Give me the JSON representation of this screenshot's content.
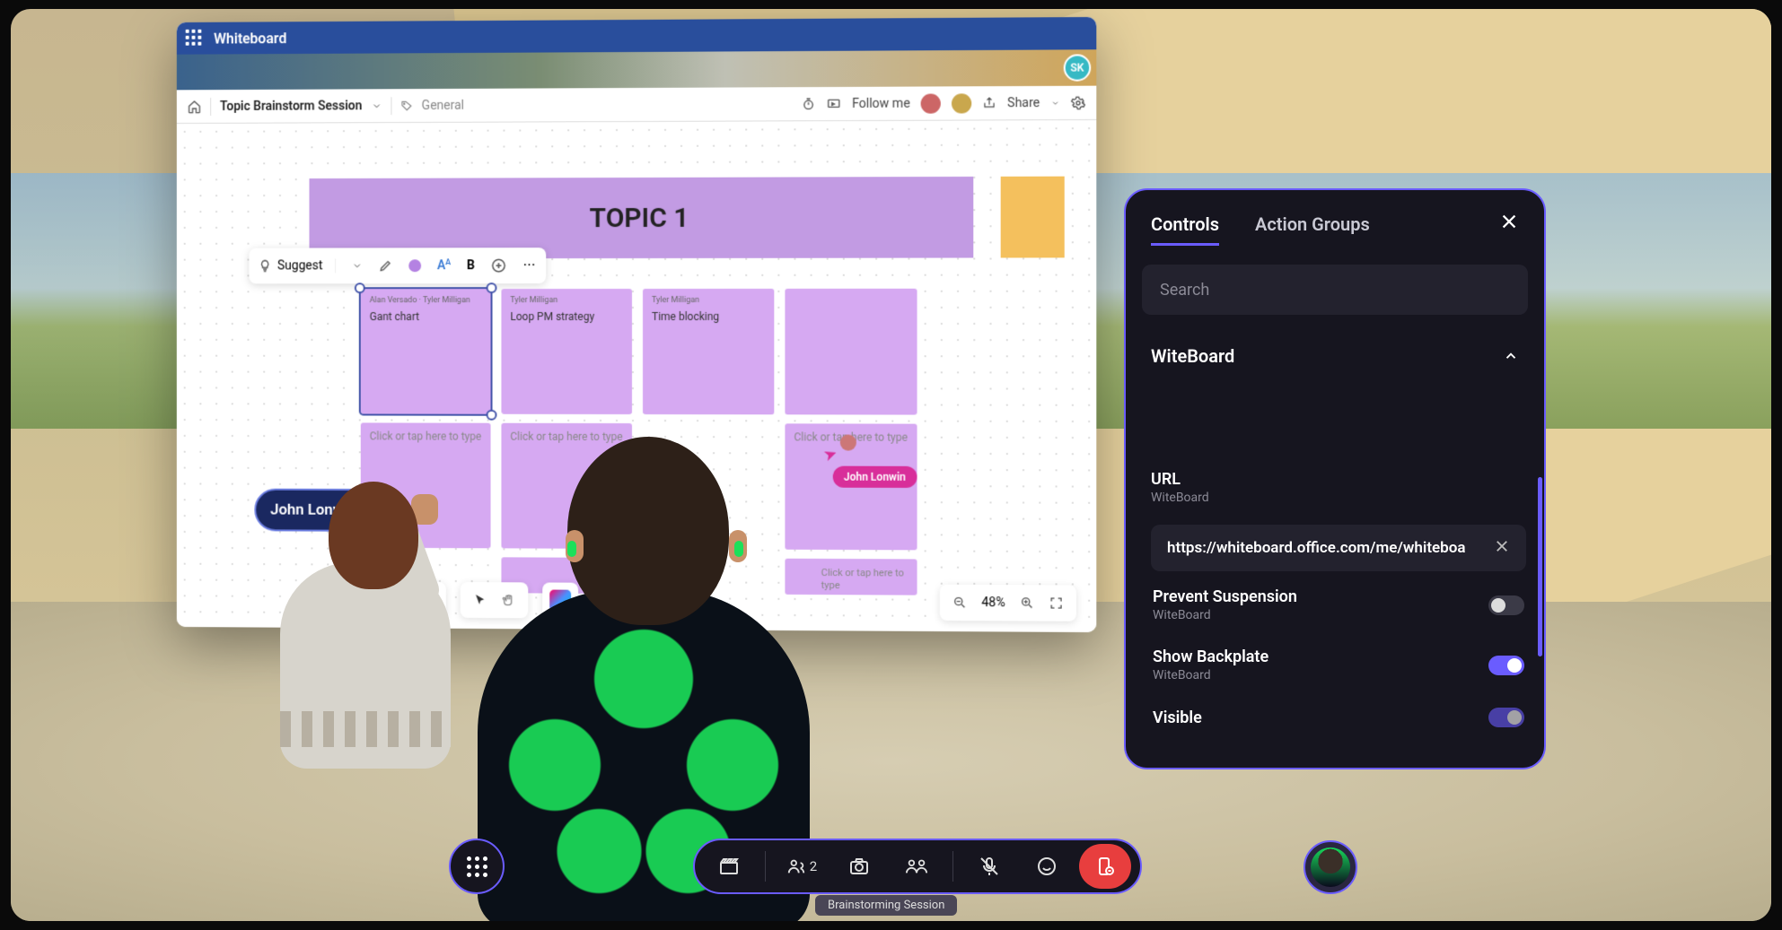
{
  "whiteboard": {
    "app_name": "Whiteboard",
    "board_title": "Topic Brainstorm Session",
    "tag": "General",
    "user_initials": "SK",
    "follow_me": "Follow me",
    "share": "Share",
    "topic_header": "TOPIC 1",
    "suggest": "Suggest",
    "zoom": "48%",
    "placeholder_text": "Click or tap here to type",
    "notes_row1": [
      {
        "author": "Alan Versado · Tyler Milligan",
        "text": "Gant chart"
      },
      {
        "author": "Tyler Milligan",
        "text": "Loop PM strategy"
      },
      {
        "author": "Tyler Milligan",
        "text": "Time blocking"
      },
      {
        "author": "",
        "text": ""
      }
    ],
    "cursor_user": "John Lonwin",
    "name_pill": "John Lonwin"
  },
  "panel": {
    "tab_controls": "Controls",
    "tab_action_groups": "Action Groups",
    "search_placeholder": "Search",
    "section_title": "WiteBoard",
    "url_label": "URL",
    "url_sub": "WiteBoard",
    "url_value": "https://whiteboard.office.com/me/whiteboa",
    "prevent_label": "Prevent Suspension",
    "prevent_sub": "WiteBoard",
    "backplate_label": "Show Backplate",
    "backplate_sub": "WiteBoard",
    "visible_label": "Visible"
  },
  "dock": {
    "participant_count": "2",
    "session_name": "Brainstorming Session"
  }
}
